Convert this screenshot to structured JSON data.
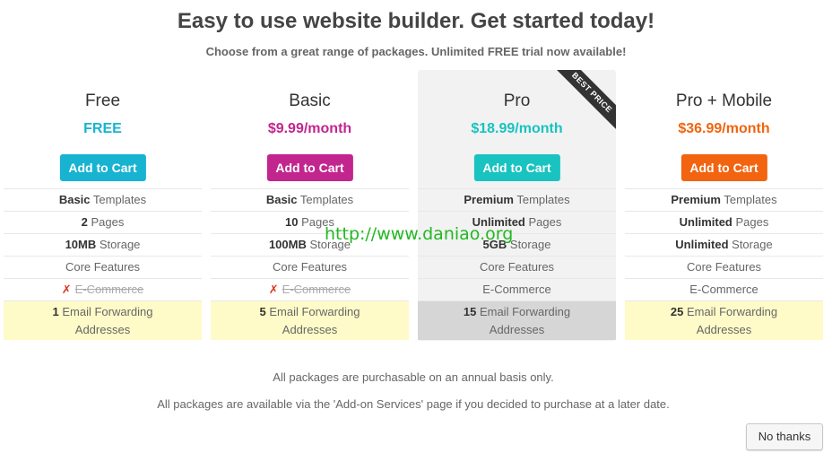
{
  "header": {
    "title": "Easy to use website builder. Get started today!",
    "subtitle": "Choose from a great range of packages. Unlimited FREE trial now available!"
  },
  "plans": [
    {
      "name": "Free",
      "price": "FREE",
      "button": "Add to Cart",
      "accent": "#17b3d1",
      "templates_bold": "Basic",
      "templates_rest": " Templates",
      "pages_bold": "2",
      "pages_rest": " Pages",
      "storage_bold": "10MB",
      "storage_rest": " Storage",
      "core": "Core Features",
      "xmark": "✗",
      "ecommerce": "E-Commerce",
      "email_bold": "1",
      "email_rest": " Email Forwarding",
      "email_line2": "Addresses"
    },
    {
      "name": "Basic",
      "price": "$9.99/month",
      "button": "Add to Cart",
      "accent": "#c3258f",
      "templates_bold": "Basic",
      "templates_rest": " Templates",
      "pages_bold": "10",
      "pages_rest": " Pages",
      "storage_bold": "100MB",
      "storage_rest": " Storage",
      "core": "Core Features",
      "xmark": "✗",
      "ecommerce": "E-Commerce",
      "email_bold": "5",
      "email_rest": " Email Forwarding",
      "email_line2": "Addresses"
    },
    {
      "name": "Pro",
      "price": "$18.99/month",
      "button": "Add to Cart",
      "accent": "#18c3c0",
      "ribbon": "BEST PRICE",
      "templates_bold": "Premium",
      "templates_rest": " Templates",
      "pages_bold": "Unlimited",
      "pages_rest": " Pages",
      "storage_bold": "5GB",
      "storage_rest": " Storage",
      "core": "Core Features",
      "ecommerce": "E-Commerce",
      "email_bold": "15",
      "email_rest": " Email Forwarding",
      "email_line2": "Addresses"
    },
    {
      "name": "Pro + Mobile",
      "price": "$36.99/month",
      "button": "Add to Cart",
      "accent": "#f2640f",
      "templates_bold": "Premium",
      "templates_rest": " Templates",
      "pages_bold": "Unlimited",
      "pages_rest": " Pages",
      "storage_bold": "Unlimited",
      "storage_rest": " Storage",
      "core": "Core Features",
      "ecommerce": "E-Commerce",
      "email_bold": "25",
      "email_rest": " Email Forwarding",
      "email_line2": "Addresses"
    }
  ],
  "watermark": "http://www.daniao.org",
  "footer": {
    "note1": "All packages are purchasable on an annual basis only.",
    "note2": "All packages are available via the 'Add-on Services' page if you decided to purchase at a later date.",
    "no_thanks": "No thanks"
  },
  "colors": {
    "email_highlight": "#fffbc8",
    "email_highlight_pro": "#d6d6d6",
    "pro_column_bg": "#f2f2f2"
  }
}
